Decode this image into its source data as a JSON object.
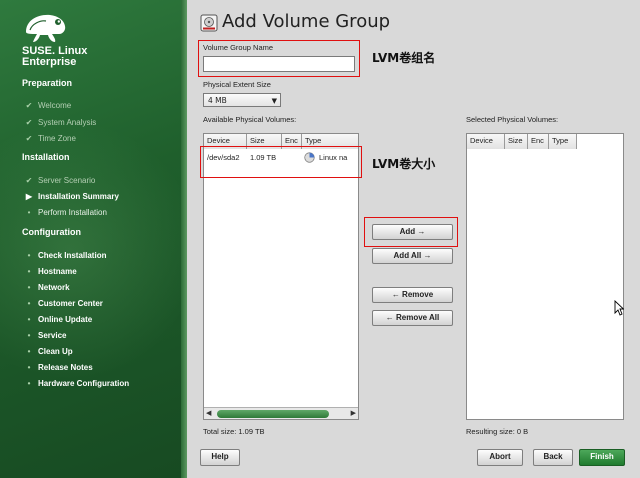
{
  "sidebar": {
    "brand_line1": "SUSE. Linux",
    "brand_line2": "Enterprise",
    "sections": [
      {
        "title": "Preparation",
        "steps": [
          {
            "label": "Welcome",
            "state": "done"
          },
          {
            "label": "System Analysis",
            "state": "done"
          },
          {
            "label": "Time Zone",
            "state": "done"
          }
        ]
      },
      {
        "title": "Installation",
        "steps": [
          {
            "label": "Server Scenario",
            "state": "done"
          },
          {
            "label": "Installation Summary",
            "state": "current"
          },
          {
            "label": "Perform Installation",
            "state": "pending"
          }
        ]
      },
      {
        "title": "Configuration",
        "steps": [
          {
            "label": "Check Installation",
            "state": "pending"
          },
          {
            "label": "Hostname",
            "state": "pending"
          },
          {
            "label": "Network",
            "state": "pending"
          },
          {
            "label": "Customer Center",
            "state": "pending"
          },
          {
            "label": "Online Update",
            "state": "pending"
          },
          {
            "label": "Service",
            "state": "pending"
          },
          {
            "label": "Clean Up",
            "state": "pending"
          },
          {
            "label": "Release Notes",
            "state": "pending"
          },
          {
            "label": "Hardware Configuration",
            "state": "pending"
          }
        ]
      }
    ]
  },
  "main": {
    "title": "Add Volume Group",
    "vg_name_label": "Volume Group Name",
    "vg_name_value": "",
    "pe_size_label": "Physical Extent Size",
    "pe_size_value": "4 MB",
    "available_label": "Available Physical Volumes:",
    "selected_label": "Selected Physical Volumes:",
    "columns": [
      "Device",
      "Size",
      "Enc",
      "Type"
    ],
    "available_rows": [
      {
        "device": "/dev/sda2",
        "size": "1.09 TB",
        "enc": "",
        "type": "Linux na"
      }
    ],
    "selected_rows": [],
    "total_size": "Total size: 1.09 TB",
    "resulting_size": "Resulting size: 0 B",
    "buttons": {
      "add": "Add →",
      "add_all": "Add All →",
      "remove": "← Remove",
      "remove_all": "← Remove All",
      "help": "Help",
      "abort": "Abort",
      "back": "Back",
      "finish": "Finish"
    }
  },
  "annotations": {
    "vg_name_note": "LVM卷组名",
    "pv_size_note": "LVM卷大小"
  },
  "colors": {
    "sidebar_green": "#1f5f2c",
    "finish_green": "#2e8a3a",
    "annotation_red": "#e01010"
  }
}
